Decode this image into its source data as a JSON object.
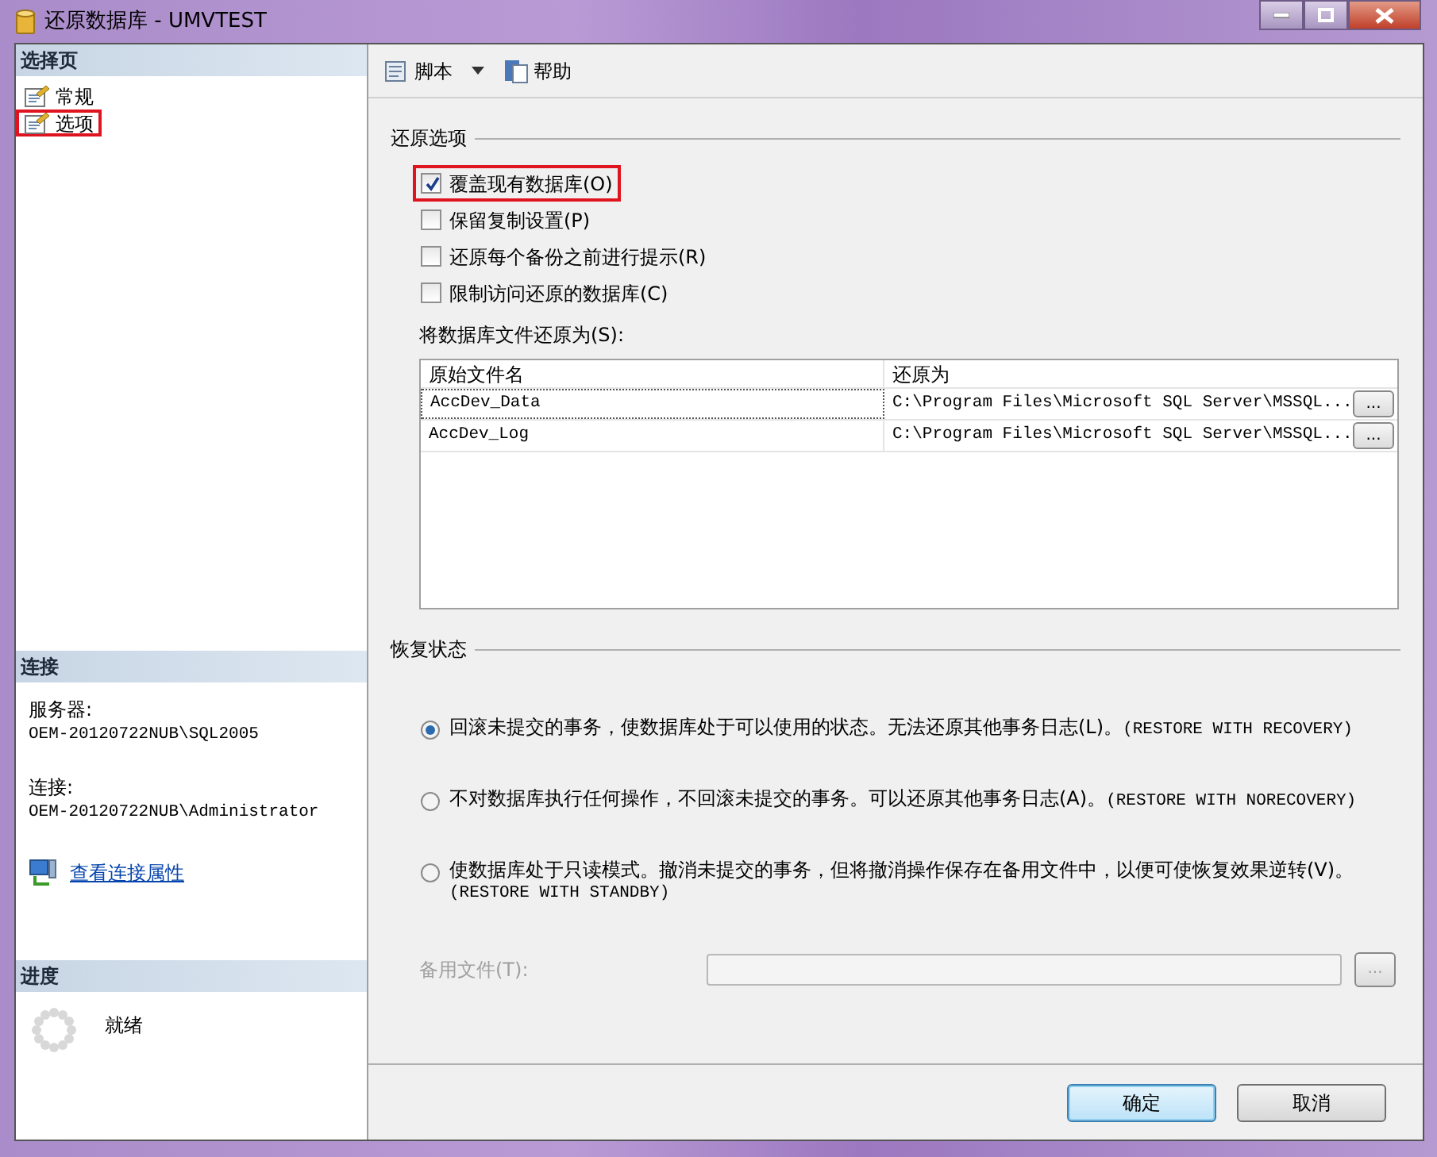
{
  "window": {
    "title": "还原数据库 - UMVTEST"
  },
  "sidebar": {
    "pages_header": "选择页",
    "pages": [
      {
        "label": "常规",
        "highlighted": false
      },
      {
        "label": "选项",
        "highlighted": true
      }
    ],
    "connection_header": "连接",
    "connection": [
      {
        "label": "服务器:",
        "value": "OEM-20120722NUB\\SQL2005"
      },
      {
        "label": "连接:",
        "value": "OEM-20120722NUB\\Administrator"
      }
    ],
    "connection_link": "查看连接属性",
    "progress_header": "进度",
    "progress_status": "就绪"
  },
  "toolbar": {
    "script_button": "脚本",
    "help_button": "帮助"
  },
  "restore_options": {
    "title": "还原选项",
    "checkboxes": [
      {
        "label": "覆盖现有数据库(O)",
        "checked": true,
        "highlighted": true
      },
      {
        "label": "保留复制设置(P)",
        "checked": false,
        "highlighted": false
      },
      {
        "label": "还原每个备份之前进行提示(R)",
        "checked": false,
        "highlighted": false
      },
      {
        "label": "限制访问还原的数据库(C)",
        "checked": false,
        "highlighted": false
      }
    ],
    "files_label": "将数据库文件还原为(S):",
    "columns": [
      "原始文件名",
      "还原为"
    ],
    "rows": [
      {
        "original": "AccDev_Data",
        "restore_as": "C:\\Program Files\\Microsoft SQL Server\\MSSQL...",
        "browse": "...",
        "selected": true
      },
      {
        "original": "AccDev_Log",
        "restore_as": "C:\\Program Files\\Microsoft SQL Server\\MSSQL...",
        "browse": "...",
        "selected": false
      }
    ]
  },
  "recovery": {
    "title": "恢复状态",
    "options": [
      {
        "text": "回滚未提交的事务，使数据库处于可以使用的状态。无法还原其他事务日志(L)。",
        "code": "(RESTORE WITH RECOVERY)",
        "selected": true
      },
      {
        "text": "不对数据库执行任何操作，不回滚未提交的事务。可以还原其他事务日志(A)。",
        "code": "(RESTORE WITH NORECOVERY)",
        "selected": false
      },
      {
        "text": "使数据库处于只读模式。撤消未提交的事务，但将撤消操作保存在备用文件中，以便可使恢复效果逆转(V)。",
        "code": "(RESTORE WITH STANDBY)",
        "selected": false
      }
    ],
    "standby_label": "备用文件(T):",
    "standby_disabled": true,
    "standby_browse": "..."
  },
  "buttons": [
    {
      "label": "确定",
      "default": true
    },
    {
      "label": "取消",
      "default": false
    }
  ]
}
